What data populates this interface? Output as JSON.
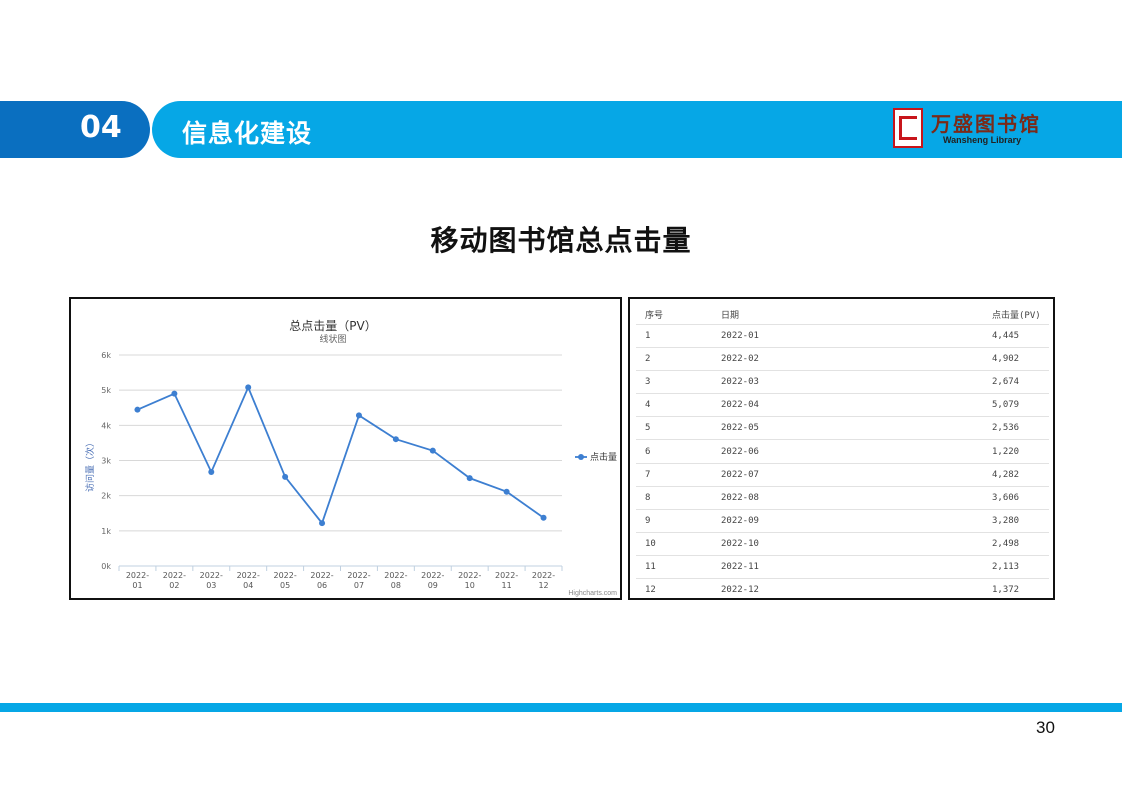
{
  "header": {
    "section_number": "04",
    "section_title": "信息化建设",
    "logo_text_cn": "万盛图书馆",
    "logo_text_en": "Wansheng Library",
    "accent_color": "#06a7e6",
    "number_box_color": "#0a6fc0"
  },
  "page": {
    "main_title": "移动图书馆总点击量",
    "page_number": "30"
  },
  "chart_data": {
    "type": "line",
    "title": "总点击量（PV）",
    "subtitle": "线状图",
    "xlabel": "",
    "ylabel": "访问量（次）",
    "categories": [
      "2022-01",
      "2022-02",
      "2022-03",
      "2022-04",
      "2022-05",
      "2022-06",
      "2022-07",
      "2022-08",
      "2022-09",
      "2022-10",
      "2022-11",
      "2022-12"
    ],
    "category_labels": [
      [
        "2022-",
        "01"
      ],
      [
        "2022-",
        "02"
      ],
      [
        "2022-",
        "03"
      ],
      [
        "2022-",
        "04"
      ],
      [
        "2022-",
        "05"
      ],
      [
        "2022-",
        "06"
      ],
      [
        "2022-",
        "07"
      ],
      [
        "2022-",
        "08"
      ],
      [
        "2022-",
        "09"
      ],
      [
        "2022-",
        "10"
      ],
      [
        "2022-",
        "11"
      ],
      [
        "2022-",
        "12"
      ]
    ],
    "series": [
      {
        "name": "点击量",
        "values": [
          4445,
          4902,
          2674,
          5079,
          2536,
          1220,
          4282,
          3606,
          3280,
          2498,
          2113,
          1372
        ],
        "color": "#3d7fd1"
      }
    ],
    "ylim": [
      0,
      6000
    ],
    "yticks": [
      0,
      1000,
      2000,
      3000,
      4000,
      5000,
      6000
    ],
    "ytick_labels": [
      "0k",
      "1k",
      "2k",
      "3k",
      "4k",
      "5k",
      "6k"
    ],
    "grid": true,
    "legend_position": "right",
    "credits": "Highcharts.com"
  },
  "table": {
    "headers": [
      "序号",
      "日期",
      "点击量(PV)"
    ],
    "rows": [
      [
        "1",
        "2022-01",
        "4,445"
      ],
      [
        "2",
        "2022-02",
        "4,902"
      ],
      [
        "3",
        "2022-03",
        "2,674"
      ],
      [
        "4",
        "2022-04",
        "5,079"
      ],
      [
        "5",
        "2022-05",
        "2,536"
      ],
      [
        "6",
        "2022-06",
        "1,220"
      ],
      [
        "7",
        "2022-07",
        "4,282"
      ],
      [
        "8",
        "2022-08",
        "3,606"
      ],
      [
        "9",
        "2022-09",
        "3,280"
      ],
      [
        "10",
        "2022-10",
        "2,498"
      ],
      [
        "11",
        "2022-11",
        "2,113"
      ],
      [
        "12",
        "2022-12",
        "1,372"
      ]
    ]
  }
}
